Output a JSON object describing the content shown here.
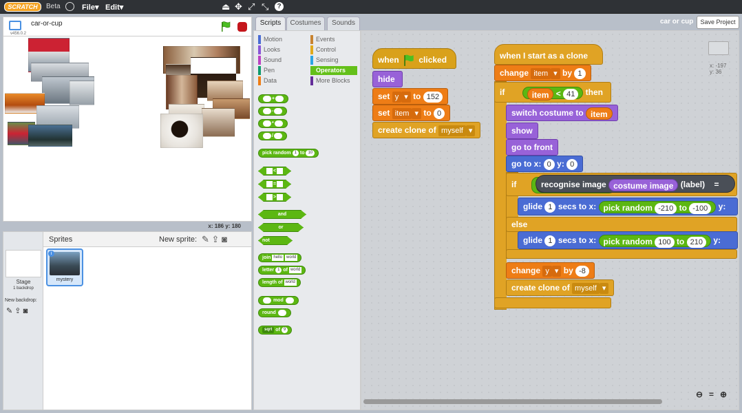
{
  "topbar": {
    "logo": "SCRATCH",
    "beta": "Beta",
    "file": "File▾",
    "edit": "Edit▾"
  },
  "stage": {
    "title": "car-or-cup",
    "version": "v456.0.2",
    "coords": "x: 186   y: 180"
  },
  "sprites": {
    "header": "Sprites",
    "new_sprite": "New sprite:",
    "stage_label": "Stage",
    "backdrops": "1 backdrop",
    "new_backdrop": "New backdrop:",
    "sprite_name": "mystery"
  },
  "tabs": {
    "scripts": "Scripts",
    "costumes": "Costumes",
    "sounds": "Sounds"
  },
  "categories": {
    "motion": "Motion",
    "looks": "Looks",
    "sound": "Sound",
    "pen": "Pen",
    "data": "Data",
    "events": "Events",
    "control": "Control",
    "sensing": "Sensing",
    "operators": "Operators",
    "more": "More Blocks"
  },
  "palette": {
    "plus": "+",
    "minus": "-",
    "times": "*",
    "div": "/",
    "pick": "pick random",
    "one": "1",
    "to": "to",
    "ten": "10",
    "lt": "<",
    "eq": "=",
    "gt": ">",
    "and": "and",
    "or": "or",
    "not": "not",
    "join": "join",
    "hello": "hello",
    "world": "world",
    "letter": "letter",
    "of": "of",
    "length": "length of",
    "mod": "mod",
    "round": "round",
    "sqrt": "sqrt",
    "nine": "9"
  },
  "header": {
    "project_name": "car or cup",
    "save": "Save Project"
  },
  "sprite_info": {
    "x": "x: -197",
    "y": "y: 36"
  },
  "script1": {
    "when": "when",
    "clicked": "clicked",
    "hide": "hide",
    "set": "set",
    "y": "y",
    "to": "to",
    "v152": "152",
    "item": "item",
    "zero": "0",
    "create_clone": "create clone of",
    "myself": "myself"
  },
  "script2": {
    "hat": "when I start as a clone",
    "change": "change",
    "item": "item",
    "by": "by",
    "one": "1",
    "if": "if",
    "lt": "<",
    "v41": "41",
    "then": "then",
    "switch": "switch costume to",
    "show": "show",
    "front": "go to front",
    "goto": "go to x:",
    "zero": "0",
    "yl": "y:",
    "recognise": "recognise image",
    "costume": "costume image",
    "label": "(label)",
    "eq": "=",
    "glide": "glide",
    "secs": "secs to x:",
    "pick": "pick random",
    "to": "to",
    "m210": "-210",
    "m100": "-100",
    "p100": "100",
    "p210": "210",
    "else": "else",
    "y": "y",
    "m8": "-8",
    "create_clone": "create clone of",
    "myself": "myself"
  }
}
